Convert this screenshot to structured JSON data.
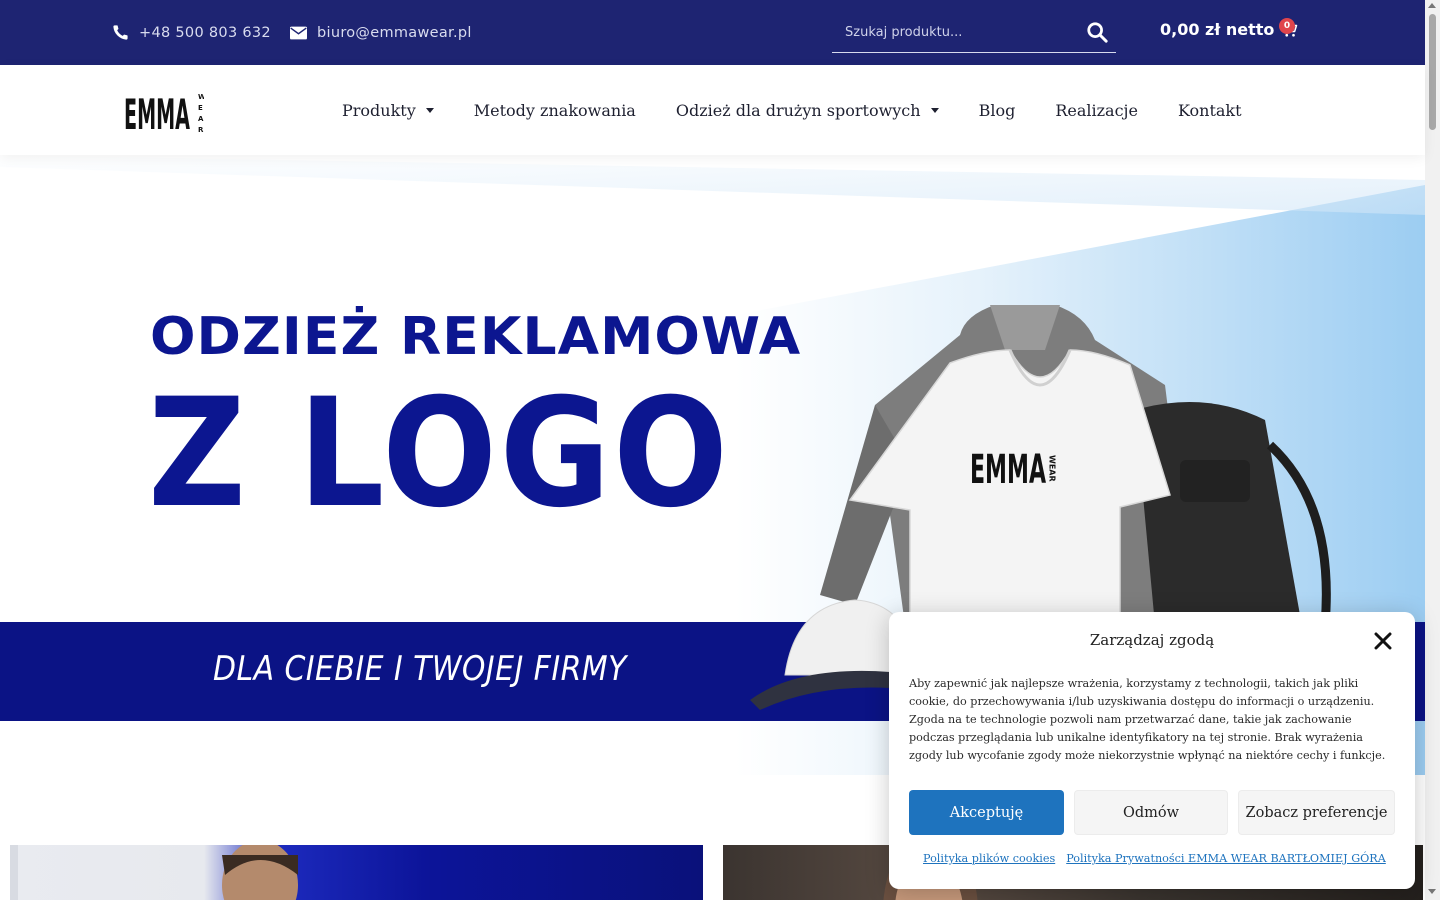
{
  "topbar": {
    "phone": "+48 500 803 632",
    "email": "biuro@emmawear.pl",
    "search_placeholder": "Szukaj produktu...",
    "cart_total": "0,00 zł netto",
    "cart_count": "0",
    "background_color": "#1e2472",
    "badge_color": "#e0454c"
  },
  "logo": {
    "text": "EMMA",
    "subtext": "WEAR"
  },
  "nav": {
    "items": [
      {
        "label": "Produkty",
        "has_dropdown": true
      },
      {
        "label": "Metody znakowania",
        "has_dropdown": false
      },
      {
        "label": "Odzież dla drużyn sportowych",
        "has_dropdown": true
      },
      {
        "label": "Blog",
        "has_dropdown": false
      },
      {
        "label": "Realizacje",
        "has_dropdown": false
      },
      {
        "label": "Kontakt",
        "has_dropdown": false
      }
    ]
  },
  "hero": {
    "line1": "ODZIEŻ REKLAMOWA",
    "line2": "Z LOGO",
    "subtitle": "DLA CIEBIE I TWOJEJ FIRMY",
    "tshirt_logo": "EMMA",
    "tshirt_logo_sub": "WEAR",
    "brand_color": "#0c1690"
  },
  "consent": {
    "title": "Zarządzaj zgodą",
    "text": "Aby zapewnić jak najlepsze wrażenia, korzystamy z technologii, takich jak pliki cookie, do przechowywania i/lub uzyskiwania dostępu do informacji o urządzeniu. Zgoda na te technologie pozwoli nam przetwarzać dane, takie jak zachowanie podczas przeglądania lub unikalne identyfikatory na tej stronie. Brak wyrażenia zgody lub wycofanie zgody może niekorzystnie wpłynąć na niektóre cechy i funkcje.",
    "accept": "Akceptuję",
    "deny": "Odmów",
    "preferences": "Zobacz preferencje",
    "link_cookies": "Polityka plików cookies",
    "link_privacy": "Polityka Prywatności EMMA WEAR BARTŁOMIEJ GÓRA",
    "accept_color": "#1e73be"
  }
}
